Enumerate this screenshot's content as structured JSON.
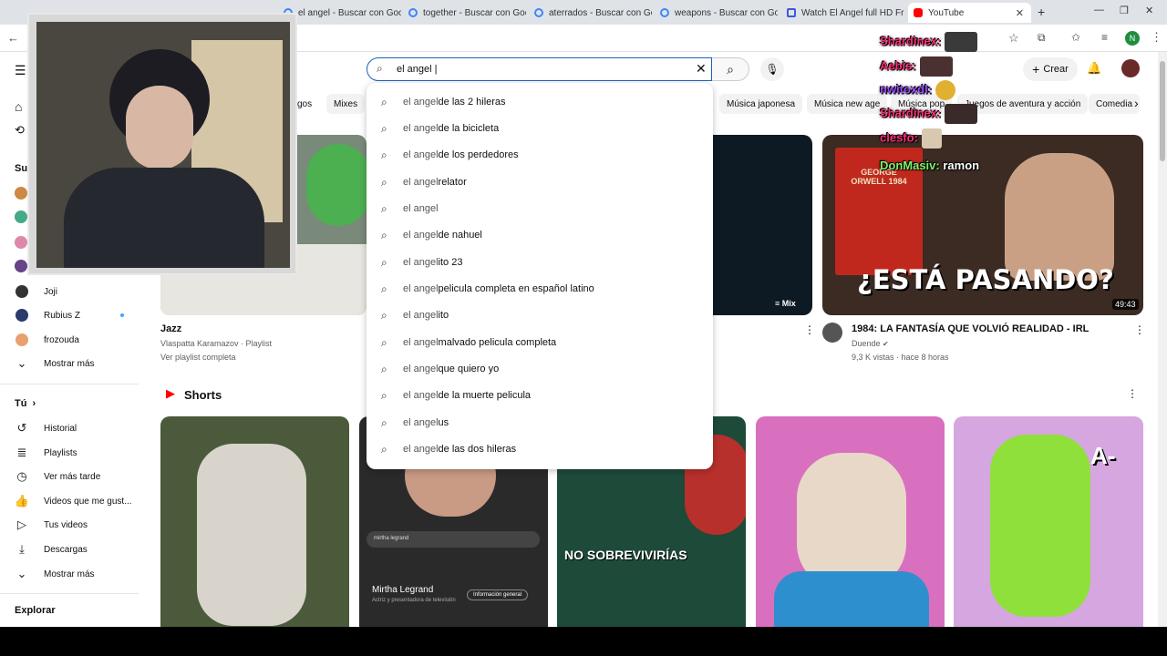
{
  "tabs": [
    {
      "title": "el angel - Buscar con Goo",
      "active": false
    },
    {
      "title": "together - Buscar con Goo",
      "active": false
    },
    {
      "title": "aterrados - Buscar con Goo",
      "active": false
    },
    {
      "title": "weapons - Buscar con Goo",
      "active": false
    },
    {
      "title": "Watch El Angel full HD Fr",
      "active": false
    },
    {
      "title": "YouTube",
      "active": true
    }
  ],
  "search": {
    "value": "el angel |",
    "suggestions": [
      {
        "prefix": "el angel",
        "rest": " de las 2 hileras"
      },
      {
        "prefix": "el angel",
        "rest": " de la bicicleta"
      },
      {
        "prefix": "el angel",
        "rest": " de los perdedores"
      },
      {
        "prefix": "el angel",
        "rest": " relator"
      },
      {
        "prefix": "el angel",
        "rest": ""
      },
      {
        "prefix": "el angel",
        "rest": " de nahuel"
      },
      {
        "prefix": "el angel",
        "rest": "ito 23"
      },
      {
        "prefix": "el angel",
        "rest": " pelicula completa en español latino"
      },
      {
        "prefix": "el angel",
        "rest": "ito"
      },
      {
        "prefix": "el angel",
        "rest": " malvado pelicula completa"
      },
      {
        "prefix": "el angel",
        "rest": " que quiero yo"
      },
      {
        "prefix": "el angel",
        "rest": " de la muerte pelicula"
      },
      {
        "prefix": "el angel",
        "rest": "us"
      },
      {
        "prefix": "el angel",
        "rest": " de las dos hileras"
      }
    ]
  },
  "header": {
    "create_label": "Crear",
    "profile_initial": "N"
  },
  "chips": [
    "gos",
    "Mixes",
    "Música japonesa",
    "Música new age",
    "Música pop",
    "Juegos de aventura y acción",
    "Comedia"
  ],
  "sidebar": {
    "subs_heading": "Su",
    "subs": [
      {
        "label": "Joji"
      },
      {
        "label": "Rubius Z"
      },
      {
        "label": "frozouda"
      }
    ],
    "show_more": "Mostrar más",
    "you_heading": "Tú",
    "you_items": [
      {
        "label": "Historial"
      },
      {
        "label": "Playlists"
      },
      {
        "label": "Ver más tarde"
      },
      {
        "label": "Videos que me gust..."
      },
      {
        "label": "Tus videos"
      },
      {
        "label": "Descargas"
      },
      {
        "label": "Mostrar más"
      }
    ],
    "explore_heading": "Explorar"
  },
  "videos": [
    {
      "title": "Jazz",
      "channel": "Vlaspatta Karamazov · Playlist",
      "meta": "Ver playlist completa"
    },
    {
      "title": "1984: LA FANTASÍA QUE VOLVIÓ  REALIDAD - IRL",
      "channel": "Duende",
      "meta": "9,3 K vistas · hace 8 horas",
      "duration": "49:43",
      "thumb_text": "¿ESTÁ PASANDO?",
      "book_title": "GEORGE ORWELL 1984"
    }
  ],
  "mix_badge": "Mix",
  "shorts": {
    "heading": "Shorts",
    "items": [
      {
        "overlay": ""
      },
      {
        "overlay": "Mirtha Legrand",
        "sub": "Actriz y presentadora de televisión",
        "search": "mirtha legrand",
        "button": "Información general"
      },
      {
        "overlay": "NO SOBREVIVIRÍAS"
      },
      {
        "overlay": ""
      },
      {
        "overlay": "A-"
      }
    ]
  },
  "chat": [
    {
      "user": "Shardinex:",
      "color": "#ff2e7a",
      "text": ""
    },
    {
      "user": "Aebis:",
      "color": "#ff2e7a",
      "text": ""
    },
    {
      "user": "nwitoxdl:",
      "color": "#9b4dff",
      "text": ""
    },
    {
      "user": "Shardinex:",
      "color": "#ff2e7a",
      "text": ""
    },
    {
      "user": "clesfo:",
      "color": "#ff2e7a",
      "text": ""
    },
    {
      "user": "DonMasiv:",
      "color": "#7cf26b",
      "text": "ramon"
    }
  ]
}
